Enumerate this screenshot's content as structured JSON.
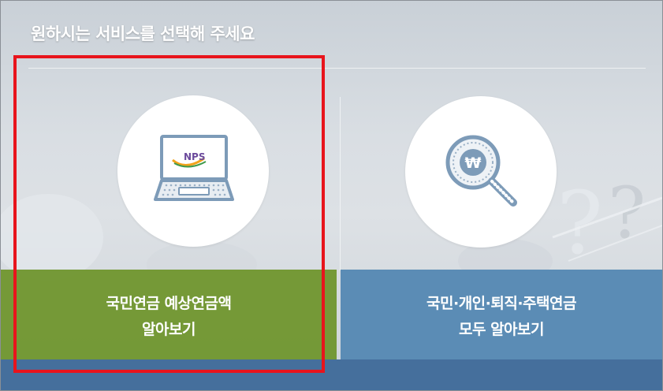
{
  "page": {
    "title": "원하시는 서비스를 선택해 주세요"
  },
  "services": [
    {
      "line1": "국민연금 예상연금액",
      "line2": "알아보기",
      "icon": "laptop-icon",
      "icon_text": "NPS",
      "color": "#709630"
    },
    {
      "line1": "국민·개인·퇴직·주택연금",
      "line2": "모두 알아보기",
      "icon": "magnifier-won-icon",
      "icon_text": "₩",
      "color": "#5b8cb5"
    }
  ],
  "highlight": {
    "color": "#e8141c",
    "target": "services.0"
  }
}
